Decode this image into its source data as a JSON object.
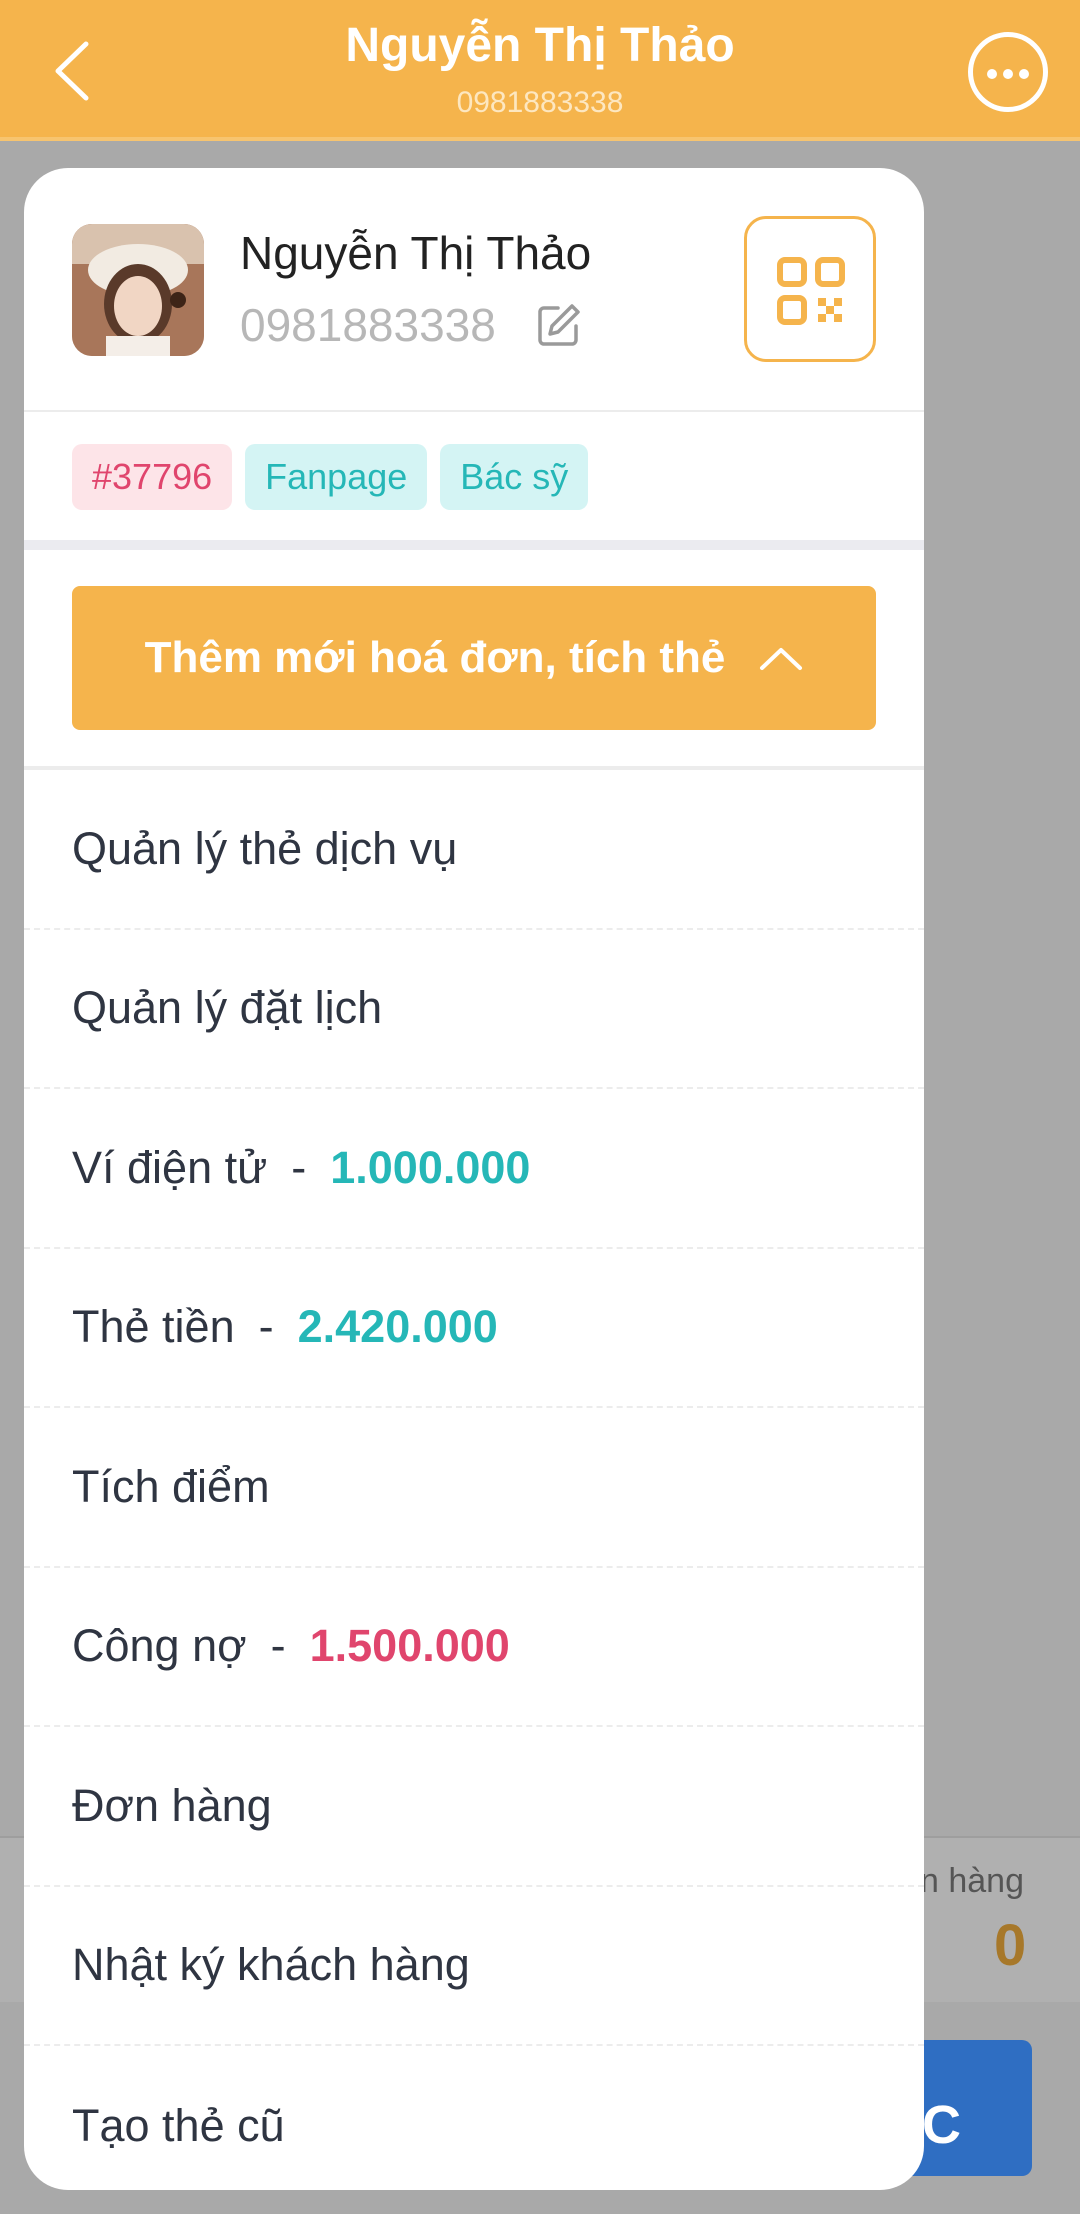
{
  "header": {
    "title": "Nguyễn Thị Thảo",
    "subtitle": "0981883338"
  },
  "background": {
    "label": "n hàng",
    "count": "0",
    "button_label": "C"
  },
  "profile": {
    "name": "Nguyễn Thị Thảo",
    "phone": "0981883338"
  },
  "tags": [
    {
      "label": "#37796"
    },
    {
      "label": "Fanpage"
    },
    {
      "label": "Bác sỹ"
    }
  ],
  "primary_button": {
    "label": "Thêm mới hoá đơn, tích thẻ"
  },
  "menu": {
    "items": [
      {
        "label": "Quản lý thẻ dịch vụ"
      },
      {
        "label": "Quản lý đặt lịch"
      },
      {
        "label": "Ví điện tử",
        "separator": "-",
        "value": "1.000.000"
      },
      {
        "label": "Thẻ tiền",
        "separator": "-",
        "value": "2.420.000"
      },
      {
        "label": "Tích điểm"
      },
      {
        "label": "Công nợ",
        "separator": "-",
        "value": "1.500.000"
      },
      {
        "label": "Đơn hàng"
      },
      {
        "label": "Nhật ký khách hàng"
      },
      {
        "label": "Tạo thẻ cũ"
      }
    ]
  },
  "colors": {
    "accent": "#f5b44c",
    "positive_value": "#25b7b7",
    "debt_value": "#e0456d"
  }
}
